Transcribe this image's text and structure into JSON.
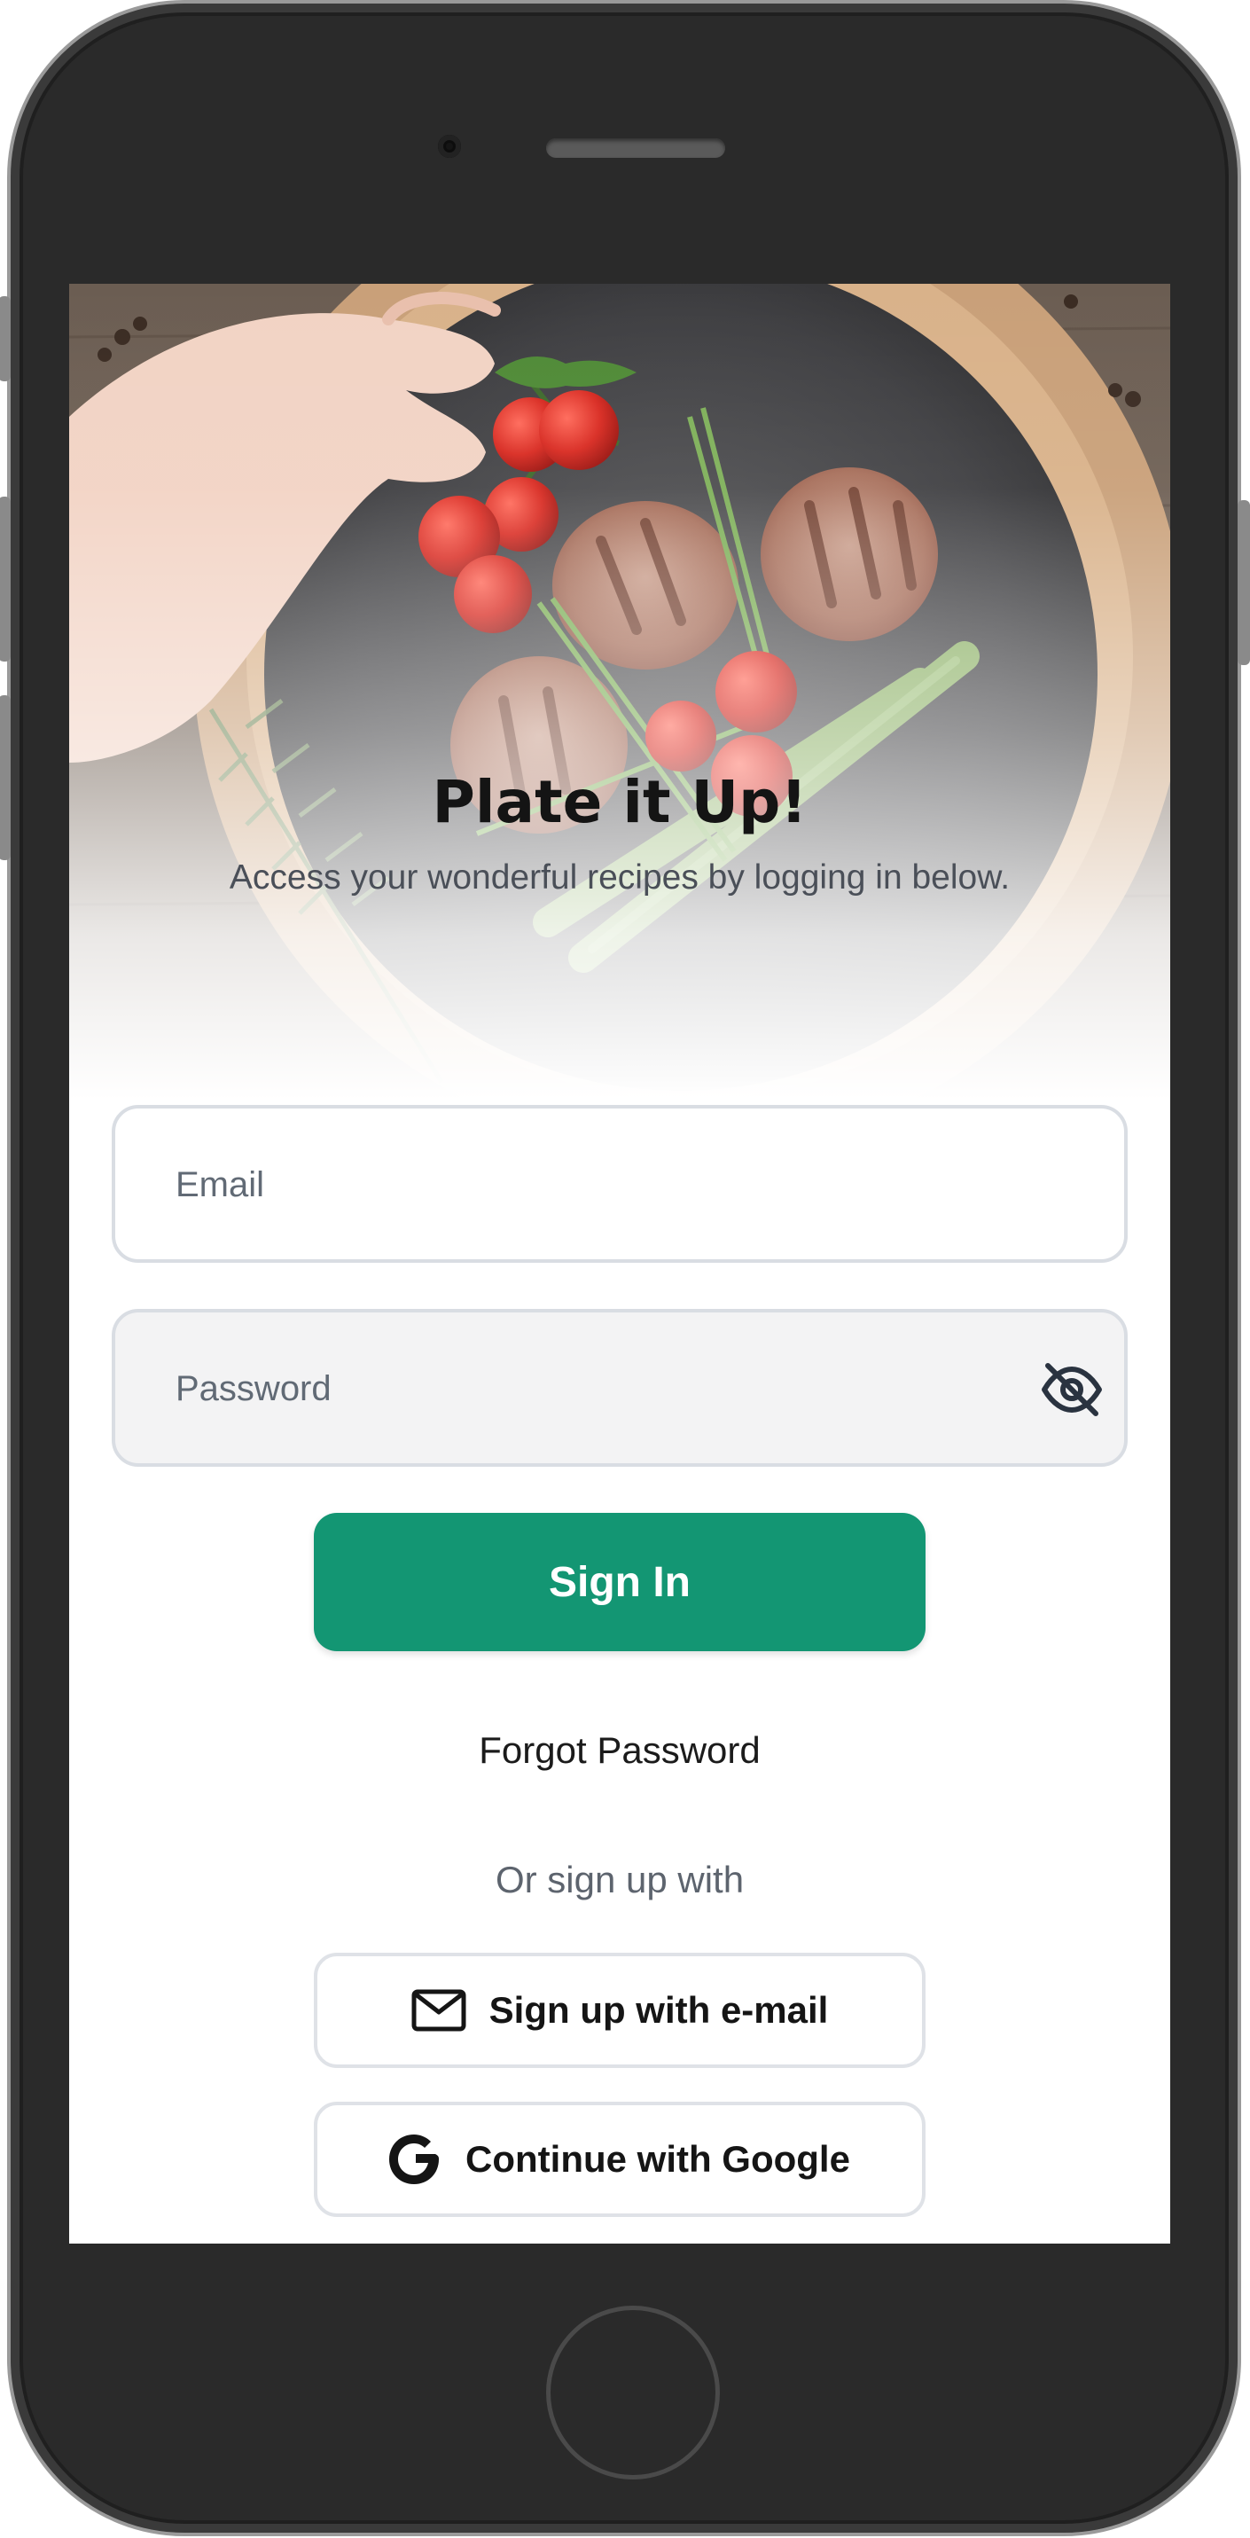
{
  "app": {
    "title": "Plate it Up!",
    "subtitle": "Access your wonderful recipes by logging in below."
  },
  "form": {
    "email_placeholder": "Email",
    "email_value": "",
    "password_placeholder": "Password",
    "password_value": "",
    "signin_label": "Sign In",
    "forgot_label": "Forgot Password"
  },
  "social": {
    "divider_text": "Or sign up with",
    "email_label": "Sign up with e-mail",
    "google_label": "Continue with Google"
  },
  "icons": {
    "password_toggle": "eye-off-icon",
    "email": "mail-icon",
    "google": "google-icon"
  },
  "colors": {
    "accent": "#139673",
    "border": "#d9dde3",
    "text_muted": "#5d646e"
  }
}
